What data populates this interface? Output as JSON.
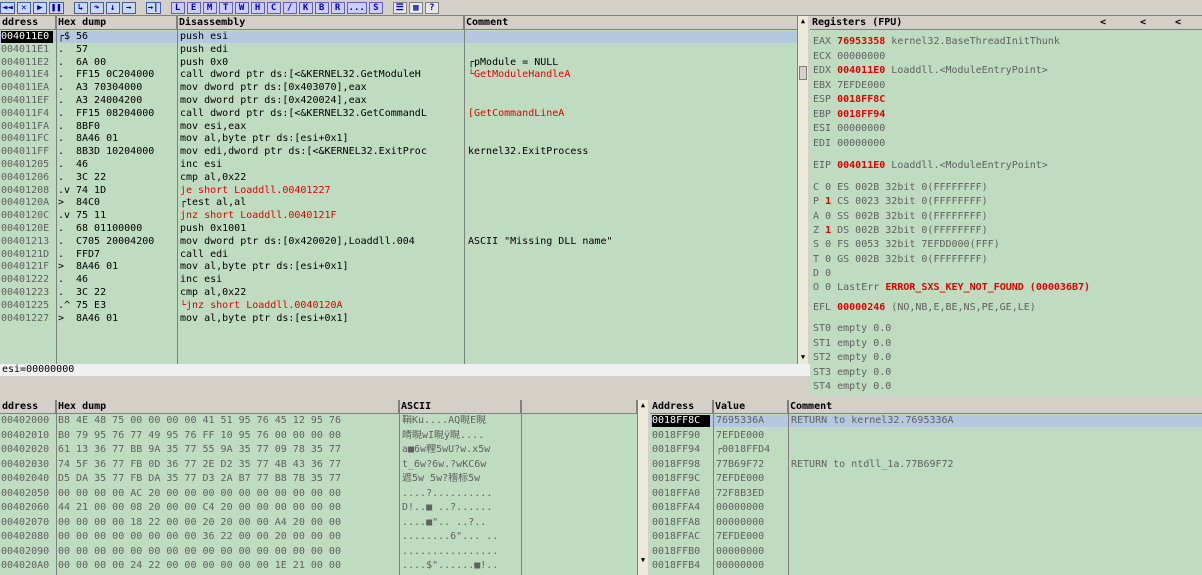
{
  "toolbar": {
    "buttons": [
      "◄◄",
      "✕",
      "▶",
      "❚❚",
      "↳",
      "↷",
      "↓",
      "→",
      "→|"
    ],
    "letters": [
      "L",
      "E",
      "M",
      "T",
      "W",
      "H",
      "C",
      "/",
      "K",
      "B",
      "R",
      "...",
      "S"
    ],
    "right_icons": [
      "☰",
      "▦",
      "?"
    ]
  },
  "disasm": {
    "headers": {
      "address": "ddress",
      "hexdump": "Hex dump",
      "disasm": "Disassembly",
      "comment": "Comment"
    },
    "rows": [
      {
        "addr": "004011E0",
        "mark": "┌$",
        "hex": "56",
        "dis": "push esi",
        "comment": ""
      },
      {
        "addr": "004011E1",
        "mark": ".",
        "hex": "57",
        "dis": "push edi",
        "comment": ""
      },
      {
        "addr": "004011E2",
        "mark": ".",
        "hex": "6A 00",
        "dis": "push 0x0",
        "comment": "┌pModule = NULL"
      },
      {
        "addr": "004011E4",
        "mark": ".",
        "hex": "FF15 0C204000",
        "dis": "call dword ptr ds:[<&KERNEL32.GetModuleH",
        "comment": "└GetModuleHandleA"
      },
      {
        "addr": "004011EA",
        "mark": ".",
        "hex": "A3 70304000",
        "dis": "mov dword ptr ds:[0x403070],eax",
        "comment": ""
      },
      {
        "addr": "004011EF",
        "mark": ".",
        "hex": "A3 24004200",
        "dis": "mov dword ptr ds:[0x420024],eax",
        "comment": ""
      },
      {
        "addr": "004011F4",
        "mark": ".",
        "hex": "FF15 08204000",
        "dis": "call dword ptr ds:[<&KERNEL32.GetCommandL",
        "comment": "[GetCommandLineA"
      },
      {
        "addr": "004011FA",
        "mark": ".",
        "hex": "8BF0",
        "dis": "mov esi,eax",
        "comment": ""
      },
      {
        "addr": "004011FC",
        "mark": ".",
        "hex": "8A46 01",
        "dis": "mov al,byte ptr ds:[esi+0x1]",
        "comment": ""
      },
      {
        "addr": "004011FF",
        "mark": ".",
        "hex": "8B3D 10204000",
        "dis": "mov edi,dword ptr ds:[<&KERNEL32.ExitProc",
        "comment": "kernel32.ExitProcess"
      },
      {
        "addr": "00401205",
        "mark": ".",
        "hex": "46",
        "dis": "inc esi",
        "comment": ""
      },
      {
        "addr": "00401206",
        "mark": ".",
        "hex": "3C 22",
        "dis": "cmp al,0x22",
        "comment": ""
      },
      {
        "addr": "00401208",
        "mark": ".v",
        "hex": "74 1D",
        "dis": "je short Loaddll.00401227",
        "comment": ""
      },
      {
        "addr": "0040120A",
        "mark": ">",
        "hex": "84C0",
        "dis": "┌test al,al",
        "comment": ""
      },
      {
        "addr": "0040120C",
        "mark": ".v",
        "hex": "75 11",
        "dis": "jnz short Loaddll.0040121F",
        "comment": ""
      },
      {
        "addr": "0040120E",
        "mark": ".",
        "hex": "68 01100000",
        "dis": "push 0x1001",
        "comment": ""
      },
      {
        "addr": "00401213",
        "mark": ".",
        "hex": "C705 20004200",
        "dis": "mov dword ptr ds:[0x420020],Loaddll.004",
        "comment": "ASCII \"Missing DLL name\""
      },
      {
        "addr": "0040121D",
        "mark": ".",
        "hex": "FFD7",
        "dis": "call edi",
        "comment": ""
      },
      {
        "addr": "0040121F",
        "mark": ">",
        "hex": "8A46 01",
        "dis": "mov al,byte ptr ds:[esi+0x1]",
        "comment": ""
      },
      {
        "addr": "00401222",
        "mark": ".",
        "hex": "46",
        "dis": "inc esi",
        "comment": ""
      },
      {
        "addr": "00401223",
        "mark": ".",
        "hex": "3C 22",
        "dis": "cmp al,0x22",
        "comment": ""
      },
      {
        "addr": "00401225",
        "mark": ".^",
        "hex": "75 E3",
        "dis": "└jnz short Loaddll.0040120A",
        "comment": ""
      },
      {
        "addr": "00401227",
        "mark": ">",
        "hex": "8A46 01",
        "dis": "mov al,byte ptr ds:[esi+0x1]",
        "comment": ""
      }
    ],
    "info": "esi=00000000"
  },
  "registers": {
    "title": "Registers (FPU)",
    "nav": [
      "<",
      "<",
      "<"
    ],
    "lines": [
      {
        "name": "EAX",
        "val": "76953358",
        "desc": "kernel32.BaseThreadInitThunk",
        "changed": true
      },
      {
        "name": "ECX",
        "val": "00000000",
        "desc": "",
        "changed": false
      },
      {
        "name": "EDX",
        "val": "004011E0",
        "desc": "Loaddll.<ModuleEntryPoint>",
        "changed": true
      },
      {
        "name": "EBX",
        "val": "7EFDE000",
        "desc": "",
        "changed": false
      },
      {
        "name": "ESP",
        "val": "0018FF8C",
        "desc": "",
        "changed": true
      },
      {
        "name": "EBP",
        "val": "0018FF94",
        "desc": "",
        "changed": true
      },
      {
        "name": "ESI",
        "val": "00000000",
        "desc": "",
        "changed": false
      },
      {
        "name": "EDI",
        "val": "00000000",
        "desc": "",
        "changed": false
      }
    ],
    "eip": {
      "name": "EIP",
      "val": "004011E0",
      "desc": "Loaddll.<ModuleEntryPoint>"
    },
    "flags": [
      {
        "f": "C",
        "v": "0",
        "seg": "ES 002B 32bit 0(FFFFFFFF)",
        "changed": false
      },
      {
        "f": "P",
        "v": "1",
        "seg": "CS 0023 32bit 0(FFFFFFFF)",
        "changed": true
      },
      {
        "f": "A",
        "v": "0",
        "seg": "SS 002B 32bit 0(FFFFFFFF)",
        "changed": false
      },
      {
        "f": "Z",
        "v": "1",
        "seg": "DS 002B 32bit 0(FFFFFFFF)",
        "changed": true
      },
      {
        "f": "S",
        "v": "0",
        "seg": "FS 0053 32bit 7EFDD000(FFF)",
        "changed": false
      },
      {
        "f": "T",
        "v": "0",
        "seg": "GS 002B 32bit 0(FFFFFFFF)",
        "changed": false
      },
      {
        "f": "D",
        "v": "0",
        "seg": "",
        "changed": false
      },
      {
        "f": "O",
        "v": "0",
        "seg": "LastErr",
        "changed": false
      }
    ],
    "lasterr": "ERROR_SXS_KEY_NOT_FOUND (000036B7)",
    "efl": {
      "name": "EFL",
      "val": "00000246",
      "desc": "(NO,NB,E,BE,NS,PE,GE,LE)"
    },
    "fpu": [
      "ST0 empty 0.0",
      "ST1 empty 0.0",
      "ST2 empty 0.0",
      "ST3 empty 0.0",
      "ST4 empty 0.0"
    ]
  },
  "dump": {
    "headers": {
      "address": "ddress",
      "hex": "Hex dump",
      "ascii": "ASCII"
    },
    "rows": [
      {
        "addr": "00402000",
        "hex": "B8 4E 48 75 00 00 00 00 41 51 95 76 45 12 95 76",
        "ascii": "鞙Ku....AQ睍E睍"
      },
      {
        "addr": "00402010",
        "hex": "B0 79 95 76 77 49 95 76 FF 10 95 76 00 00 00 00",
        "ascii": "皘睍wI睍ÿ睍...."
      },
      {
        "addr": "00402020",
        "hex": "61 13 36 77 BB 9A 35 77 55 9A 35 77 09 78 35 77",
        "ascii": "a■6w粴5wU?w.x5w"
      },
      {
        "addr": "00402030",
        "hex": "74 5F 36 77 FB 0D 36 77 2E D2 35 77 4B 43 36 77",
        "ascii": "t_6w?6w.?wKC6w"
      },
      {
        "addr": "00402040",
        "hex": "D5 DA 35 77 FB DA 35 77 D3 2A B7 77 B8 7B 35 77",
        "ascii": "遮5w  5w?稽标5w"
      },
      {
        "addr": "00402050",
        "hex": "00 00 00 00 AC 20 00 00 00 00 00 00 00 00 00 00",
        "ascii": "....?.........."
      },
      {
        "addr": "00402060",
        "hex": "44 21 00 00 08 20 00 00 C4 20 00 00 00 00 00 00",
        "ascii": "D!..■ ..?......"
      },
      {
        "addr": "00402070",
        "hex": "00 00 00 00 18 22 00 00 20 20 00 00 A4 20 00 00",
        "ascii": "....■\"..  ..?.."
      },
      {
        "addr": "00402080",
        "hex": "00 00 00 00 00 00 00 00 36 22 00 00 20 00 00 00",
        "ascii": "........6\"... .."
      },
      {
        "addr": "00402090",
        "hex": "00 00 00 00 00 00 00 00 00 00 00 00 00 00 00 00",
        "ascii": "................"
      },
      {
        "addr": "004020A0",
        "hex": "00 00 00 00 24 22 00 00 00 00 00 00 1E 21 00 00",
        "ascii": "....$\"......■!.."
      }
    ]
  },
  "stack": {
    "headers": {
      "address": "Address",
      "value": "Value",
      "comment": "Comment"
    },
    "rows": [
      {
        "addr": "0018FF8C",
        "val": "7695336A",
        "comment": "RETURN to kernel32.7695336A",
        "sel": true
      },
      {
        "addr": "0018FF90",
        "val": "7EFDE000",
        "comment": ""
      },
      {
        "addr": "0018FF94",
        "val": "┌0018FFD4",
        "comment": ""
      },
      {
        "addr": "0018FF98",
        "val": "77B69F72",
        "comment": "RETURN to ntdll_1a.77B69F72"
      },
      {
        "addr": "0018FF9C",
        "val": "7EFDE000",
        "comment": ""
      },
      {
        "addr": "0018FFA0",
        "val": "72F8B3ED",
        "comment": ""
      },
      {
        "addr": "0018FFA4",
        "val": "00000000",
        "comment": ""
      },
      {
        "addr": "0018FFA8",
        "val": "00000000",
        "comment": ""
      },
      {
        "addr": "0018FFAC",
        "val": "7EFDE000",
        "comment": ""
      },
      {
        "addr": "0018FFB0",
        "val": "00000000",
        "comment": ""
      },
      {
        "addr": "0018FFB4",
        "val": "00000000",
        "comment": ""
      }
    ]
  },
  "colors": {
    "pane_bg": "#c0dcc0",
    "chrome": "#d4d0c8",
    "changed": "#e00000",
    "selected": "#b4c8e0"
  }
}
